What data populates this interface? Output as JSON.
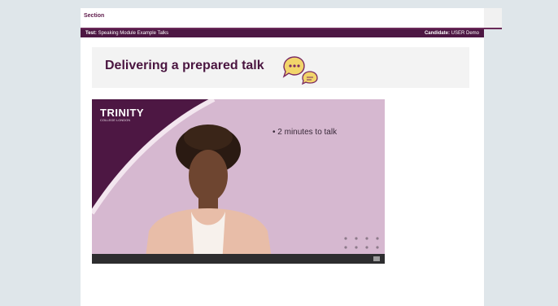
{
  "header": {
    "section_label": "Section"
  },
  "test_bar": {
    "test_label": "Test:",
    "test_value": "Speaking Module Example Talks",
    "candidate_label": "Candidate:",
    "candidate_value": "USER Demo"
  },
  "title": {
    "text": "Delivering a prepared talk"
  },
  "video": {
    "brand": "TRINITY",
    "brand_sub": "COLLEGE LONDON",
    "bullet": "•  2 minutes to talk"
  },
  "colors": {
    "brand_purple": "#4d1743",
    "slide_background": "#d6b8d0",
    "bubble_yellow": "#f2d56b"
  },
  "icons": [
    "speech-bubbles-icon",
    "fullscreen-icon"
  ]
}
